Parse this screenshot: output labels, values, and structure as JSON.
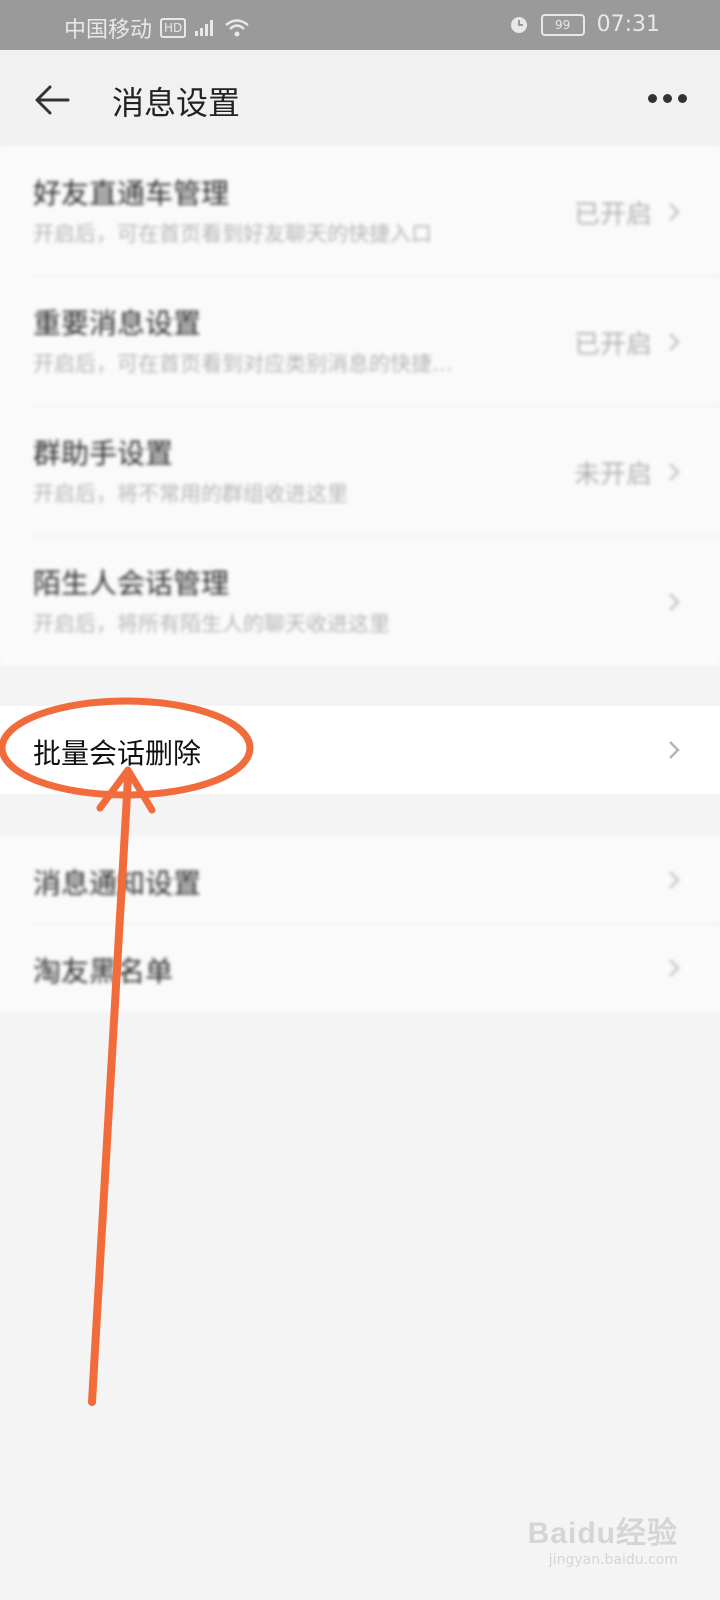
{
  "status_bar": {
    "carrier": "中国移动",
    "hd_badge": "HD",
    "battery": "99",
    "time": "07:31"
  },
  "header": {
    "title": "消息设置"
  },
  "settings": [
    {
      "title": "好友直通车管理",
      "desc": "开启后，可在首页看到好友聊天的快捷入口",
      "status": "已开启"
    },
    {
      "title": "重要消息设置",
      "desc": "开启后，可在首页看到对应类别消息的快捷…",
      "status": "已开启"
    },
    {
      "title": "群助手设置",
      "desc": "开启后，将不常用的群组收进这里",
      "status": "未开启"
    },
    {
      "title": "陌生人会话管理",
      "desc": "开启后，将所有陌生人的聊天收进这里",
      "status": ""
    }
  ],
  "batch_delete": {
    "title": "批量会话删除"
  },
  "more_settings": [
    {
      "title": "消息通知设置"
    },
    {
      "title": "淘友黑名单"
    }
  ],
  "annotation": {
    "color": "#f26b3a"
  },
  "watermark": {
    "logo": "Baidu经验",
    "url": "jingyan.baidu.com"
  }
}
